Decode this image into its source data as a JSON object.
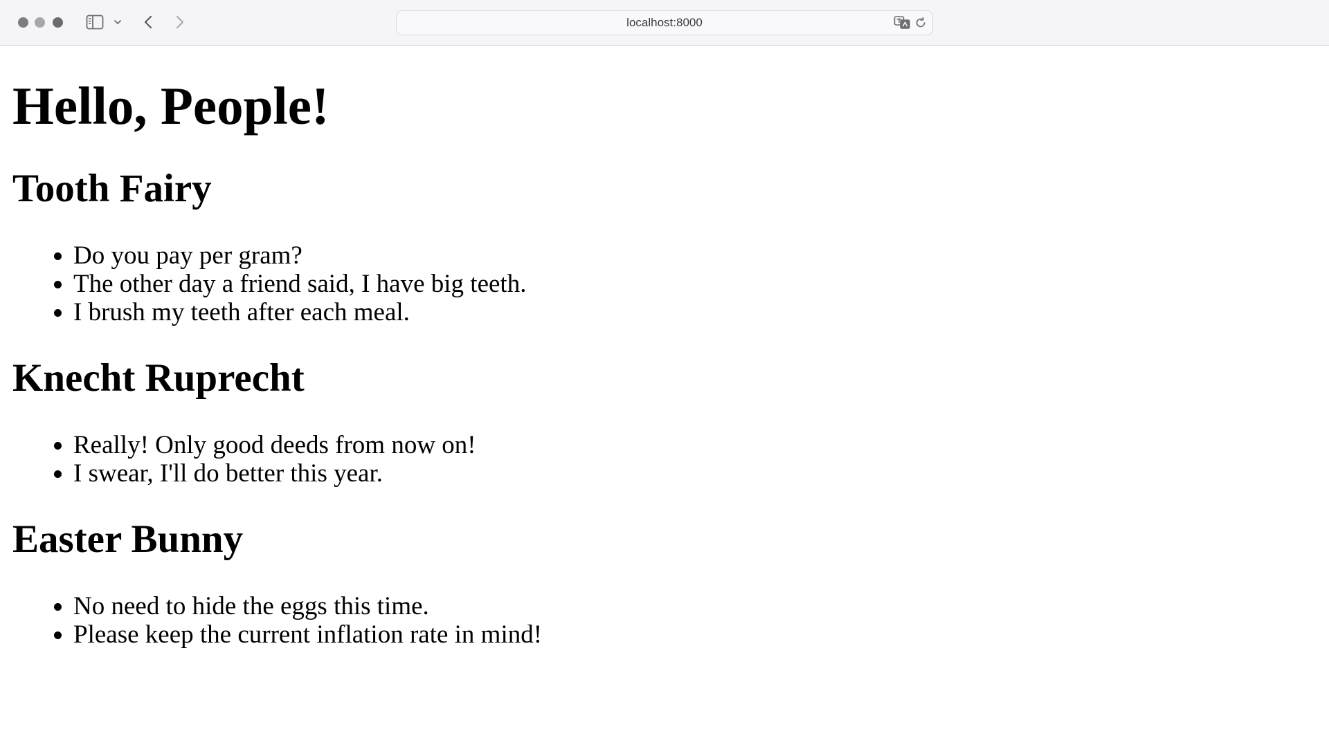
{
  "browser": {
    "address": "localhost:8000"
  },
  "page": {
    "heading": "Hello, People!",
    "sections": [
      {
        "title": "Tooth Fairy",
        "items": [
          "Do you pay per gram?",
          "The other day a friend said, I have big teeth.",
          "I brush my teeth after each meal."
        ]
      },
      {
        "title": "Knecht Ruprecht",
        "items": [
          "Really! Only good deeds from now on!",
          "I swear, I'll do better this year."
        ]
      },
      {
        "title": "Easter Bunny",
        "items": [
          "No need to hide the eggs this time.",
          "Please keep the current inflation rate in mind!"
        ]
      }
    ]
  },
  "icons": {
    "sidebar": "sidebar-icon",
    "sidebar_menu": "chevron-down-icon",
    "back": "chevron-left-icon",
    "forward": "chevron-right-icon",
    "translate": "translate-icon",
    "reload": "reload-icon"
  },
  "colors": {
    "toolbar_bg": "#f5f5f7",
    "page_bg": "#ffffff",
    "text": "#000000"
  }
}
